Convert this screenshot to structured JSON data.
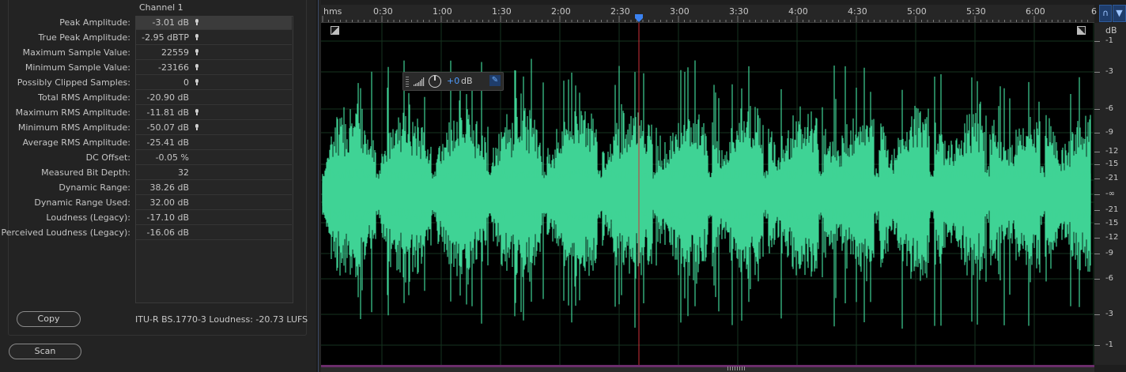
{
  "stats": {
    "channel_header": "Channel 1",
    "rows": [
      {
        "label": "Peak Amplitude:",
        "value": "-3.01 dB",
        "pin": true,
        "selected": true
      },
      {
        "label": "True Peak Amplitude:",
        "value": "-2.95 dBTP",
        "pin": true
      },
      {
        "label": "Maximum Sample Value:",
        "value": "22559",
        "pin": true
      },
      {
        "label": "Minimum Sample Value:",
        "value": "-23166",
        "pin": true
      },
      {
        "label": "Possibly Clipped Samples:",
        "value": "0",
        "pin": true
      },
      {
        "label": "Total RMS Amplitude:",
        "value": "-20.90 dB",
        "pin": false
      },
      {
        "label": "Maximum RMS Amplitude:",
        "value": "-11.81 dB",
        "pin": true
      },
      {
        "label": "Minimum RMS Amplitude:",
        "value": "-50.07 dB",
        "pin": true
      },
      {
        "label": "Average RMS Amplitude:",
        "value": "-25.41 dB",
        "pin": false
      },
      {
        "label": "DC Offset:",
        "value": "-0.05 %",
        "pin": false
      },
      {
        "label": "Measured Bit Depth:",
        "value": "32",
        "pin": false
      },
      {
        "label": "Dynamic Range:",
        "value": "38.26 dB",
        "pin": false
      },
      {
        "label": "Dynamic Range Used:",
        "value": "32.00 dB",
        "pin": false
      },
      {
        "label": "Loudness (Legacy):",
        "value": "-17.10 dB",
        "pin": false
      },
      {
        "label": "Perceived Loudness (Legacy):",
        "value": "-16.06 dB",
        "pin": false
      }
    ],
    "copy_label": "Copy",
    "scan_label": "Scan",
    "itu_loudness": "ITU-R BS.1770-3 Loudness:  -20.73 LUFS"
  },
  "timeline": {
    "unit": "hms",
    "ticks": [
      {
        "label": "0:30",
        "seconds": 30
      },
      {
        "label": "1:00",
        "seconds": 60
      },
      {
        "label": "1:30",
        "seconds": 90
      },
      {
        "label": "2:00",
        "seconds": 120
      },
      {
        "label": "2:30",
        "seconds": 150
      },
      {
        "label": "3:00",
        "seconds": 180
      },
      {
        "label": "3:30",
        "seconds": 210
      },
      {
        "label": "4:00",
        "seconds": 240
      },
      {
        "label": "4:30",
        "seconds": 270
      },
      {
        "label": "5:00",
        "seconds": 300
      },
      {
        "label": "5:30",
        "seconds": 330
      },
      {
        "label": "6:00",
        "seconds": 360
      },
      {
        "label": "6",
        "seconds": 390
      }
    ],
    "playhead_seconds": 160
  },
  "hud": {
    "value": "+0",
    "unit": "dB"
  },
  "db_scale": {
    "unit": "dB",
    "labels": [
      "-1",
      "-3",
      "-6",
      "-9",
      "-12",
      "-15",
      "-21",
      "-∞",
      "-21",
      "-15",
      "-12",
      "-9",
      "-6",
      "-3",
      "-1"
    ]
  },
  "colors": {
    "waveform": "#3fd395",
    "playhead": "#d0303a",
    "accent": "#4f9cff"
  }
}
